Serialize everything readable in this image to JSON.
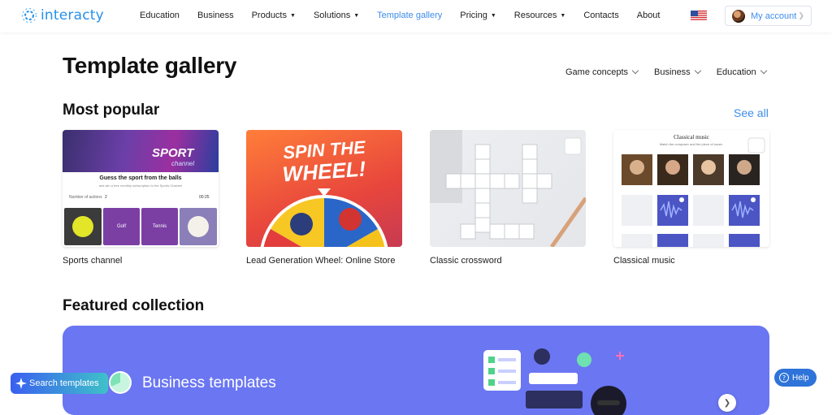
{
  "header": {
    "logo_text": "interacty",
    "nav": [
      {
        "label": "Education",
        "dropdown": false,
        "active": false
      },
      {
        "label": "Business",
        "dropdown": false,
        "active": false
      },
      {
        "label": "Products",
        "dropdown": true,
        "active": false
      },
      {
        "label": "Solutions",
        "dropdown": true,
        "active": false
      },
      {
        "label": "Template gallery",
        "dropdown": false,
        "active": true
      },
      {
        "label": "Pricing",
        "dropdown": true,
        "active": false
      },
      {
        "label": "Resources",
        "dropdown": true,
        "active": false
      },
      {
        "label": "Contacts",
        "dropdown": false,
        "active": false
      },
      {
        "label": "About",
        "dropdown": false,
        "active": false
      }
    ],
    "account_label": "My account",
    "language_flag": "us-flag-icon"
  },
  "page_title": "Template gallery",
  "filters": [
    "Game concepts",
    "Business",
    "Education"
  ],
  "most_popular": {
    "title": "Most popular",
    "see_all": "See all",
    "cards": [
      {
        "label": "Sports channel",
        "thumb": {
          "brand": "SPORT",
          "brand_sub": "channel",
          "question": "Guess the sport from the balls",
          "question_sub": "and win a free monthly subscription to the Sports Channel",
          "actions_label": "Number of actions",
          "actions_count": "2",
          "timer": "00:25",
          "options": [
            "",
            "Golf",
            "Tennis",
            ""
          ]
        }
      },
      {
        "label": "Lead Generation Wheel: Online Store",
        "thumb": {
          "line1": "SPIN THE",
          "line2": "WHEEL!"
        }
      },
      {
        "label": "Classic crossword",
        "thumb": {}
      },
      {
        "label": "Classical music",
        "thumb": {
          "title": "Classical music",
          "subtitle": "Match the composer and the piece of music."
        }
      }
    ]
  },
  "featured": {
    "title": "Featured collection",
    "banner_title": "Business templates"
  },
  "floating": {
    "search_label": "Search templates",
    "help_label": "Help"
  },
  "colors": {
    "accent": "#3d8de9",
    "banner": "#6a76f2",
    "help": "#2e73d9"
  }
}
